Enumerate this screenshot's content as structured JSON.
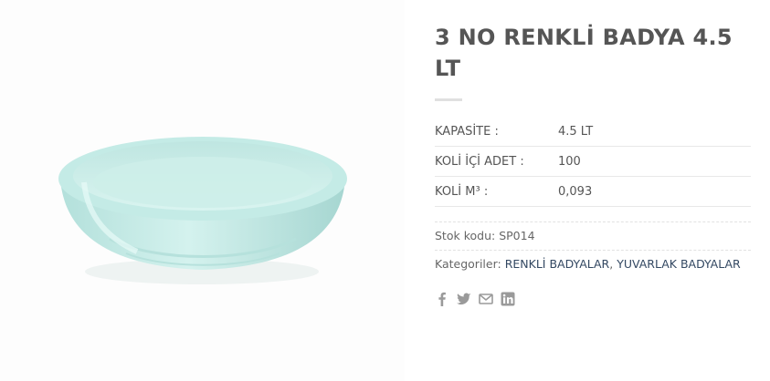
{
  "product": {
    "title": "3 NO RENKLİ BADYA 4.5 LT",
    "image_alt": "Light turquoise round plastic basin",
    "attributes": [
      {
        "key": "KAPASİTE :",
        "value": "4.5 LT"
      },
      {
        "key": "KOLİ İÇİ ADET :",
        "value": "100"
      },
      {
        "key": "KOLİ M³ :",
        "value": "0,093"
      }
    ],
    "sku_label": "Stok kodu:",
    "sku": "SP014",
    "categories_label": "Kategoriler:",
    "categories": [
      "RENKLİ BADYALAR",
      "YUVARLAK BADYALAR"
    ],
    "category_separator": ","
  },
  "share": {
    "icons": [
      "facebook-icon",
      "twitter-icon",
      "email-icon",
      "linkedin-icon"
    ],
    "color": "#9a9a9a"
  },
  "colors": {
    "basin": "#c8ece8",
    "basin_shadow": "#a9d9d4",
    "title": "#555555",
    "link": "#334862"
  }
}
